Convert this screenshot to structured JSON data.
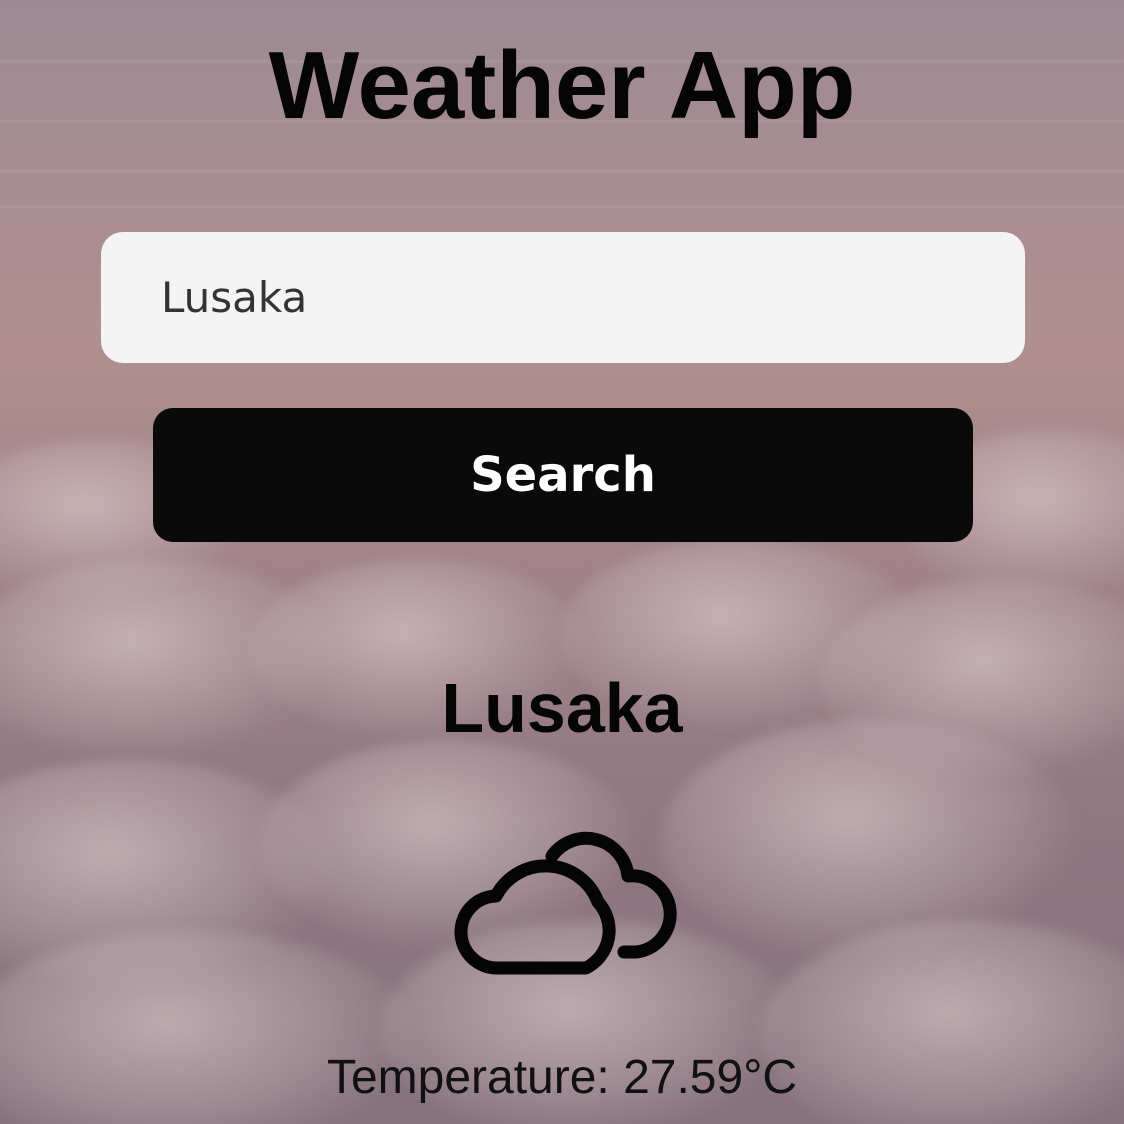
{
  "app": {
    "title": "Weather App"
  },
  "search": {
    "value": "Lusaka",
    "button_label": "Search"
  },
  "weather": {
    "city": "Lusaka",
    "icon": "cloudy-icon",
    "temperature_text": "Temperature: 27.59°C"
  },
  "colors": {
    "button_background": "#0a0a0a",
    "button_text": "#ffffff",
    "input_background": "#f4f4f4",
    "text_primary": "#050505"
  }
}
